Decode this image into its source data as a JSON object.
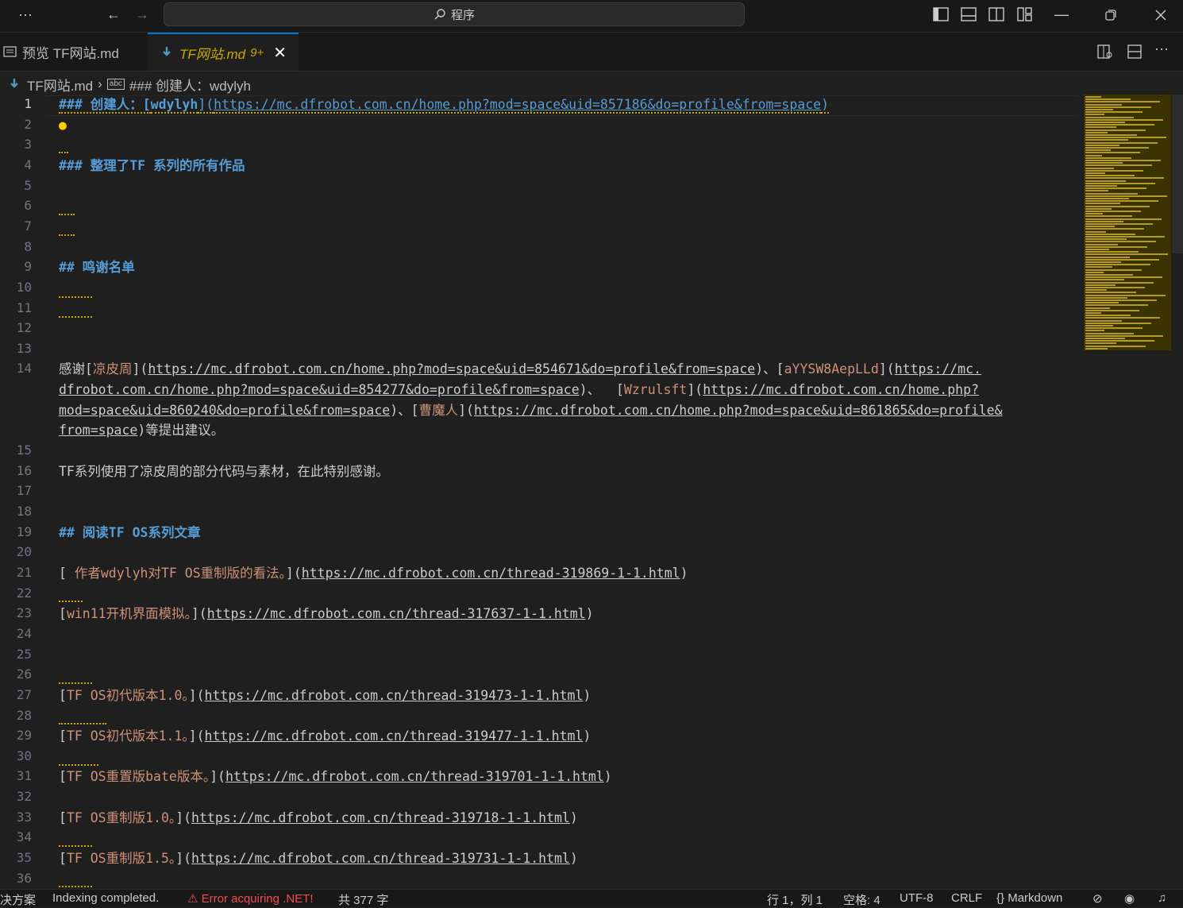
{
  "titlebar": {
    "menu_icon": "ellipsis-icon",
    "search_label": "程序",
    "nav_back": "←",
    "nav_forward": "→"
  },
  "tabs": [
    {
      "label": "预览 TF网站.md",
      "active": false
    },
    {
      "label": "TF网站.md",
      "badge": "9+",
      "active": true
    }
  ],
  "breadcrumb": {
    "file": "TF网站.md",
    "symbol": "### 创建人：wdylyh"
  },
  "editor": {
    "current_line": 1,
    "line_numbers": [
      "1",
      "2",
      "3",
      "4",
      "5",
      "6",
      "7",
      "8",
      "9",
      "10",
      "11",
      "12",
      "13",
      "14",
      "15",
      "16",
      "17",
      "18",
      "19",
      "20",
      "21",
      "22",
      "23",
      "24",
      "25",
      "26",
      "27",
      "28",
      "29",
      "30",
      "31",
      "32",
      "33",
      "34",
      "35",
      "36"
    ],
    "lines": {
      "l1": {
        "hash": "### 创建人：[",
        "link": "wdylyh",
        "mid": "](",
        "url": "https://mc.dfrobot.com.cn/home.php?mod=space&uid=857186&do=profile&from=space",
        "end": ")"
      },
      "l4": "### 整理了TF 系列的所有作品",
      "l9": "## 鸣谢名单",
      "l14a": {
        "pre": "感谢[",
        "n1": "凉皮周",
        "m1": "](",
        "u1": "https://mc.dfrobot.com.cn/home.php?mod=space&uid=854671&do=profile&from=space",
        "s1": ")、[",
        "n2": "aYYSW8AepLLd",
        "m2": "](",
        "u2": "https://mc."
      },
      "l14b": {
        "u2b": "dfrobot.com.cn/home.php?mod=space&uid=854277&do=profile&from=space",
        "s2": ")、  [",
        "n3": "Wzrulsft",
        "m3": "](",
        "u3": "https://mc.dfrobot.com.cn/home.php?"
      },
      "l14c": {
        "u3b": "mod=space&uid=860240&do=profile&from=space",
        "s3": ")、[",
        "n4": "曹魔人",
        "m4": "](",
        "u4": "https://mc.dfrobot.com.cn/home.php?mod=space&uid=861865&do=profile&"
      },
      "l14d": {
        "u4b": "from=space",
        "end": ")等提出建议。"
      },
      "l16": "TF系列使用了凉皮周的部分代码与素材，在此特别感谢。",
      "l19": "## 阅读TF OS系列文章",
      "l21": {
        "open": "[ ",
        "text": "作者wdylyh对TF OS重制版的看法。",
        "mid": "](",
        "url": "https://mc.dfrobot.com.cn/thread-319869-1-1.html",
        "end": ")"
      },
      "l23": {
        "open": "[",
        "text": "win11开机界面模拟。",
        "mid": "](",
        "url": "https://mc.dfrobot.com.cn/thread-317637-1-1.html",
        "end": ")"
      },
      "l27": {
        "open": "[",
        "text": "TF OS初代版本1.0。",
        "mid": "](",
        "url": "https://mc.dfrobot.com.cn/thread-319473-1-1.html",
        "end": ")"
      },
      "l29": {
        "open": "[",
        "text": "TF OS初代版本1.1。",
        "mid": "](",
        "url": "https://mc.dfrobot.com.cn/thread-319477-1-1.html",
        "end": ")"
      },
      "l31": {
        "open": "[",
        "text": "TF OS重置版bate版本。",
        "mid": "](",
        "url": "https://mc.dfrobot.com.cn/thread-319701-1-1.html",
        "end": ")"
      },
      "l33": {
        "open": "[",
        "text": "TF OS重制版1.0。",
        "mid": "](",
        "url": "https://mc.dfrobot.com.cn/thread-319718-1-1.html",
        "end": ")"
      },
      "l35": {
        "open": "[",
        "text": "TF OS重制版1.5。",
        "mid": "](",
        "url": "https://mc.dfrobot.com.cn/thread-319731-1-1.html",
        "end": ")"
      }
    }
  },
  "statusbar": {
    "left_cut": "决方案",
    "indexing": "Indexing completed.",
    "error": "Error acquiring .NET!",
    "wordcount": "共 377 字",
    "position": "行 1，列 1",
    "spaces": "空格: 4",
    "encoding": "UTF-8",
    "eol": "CRLF",
    "language": "Markdown"
  },
  "colors": {
    "accent": "#0078d4",
    "warning": "#cca700",
    "heading": "#569cd6",
    "linktext": "#ce9178",
    "error": "#f14c4c"
  }
}
